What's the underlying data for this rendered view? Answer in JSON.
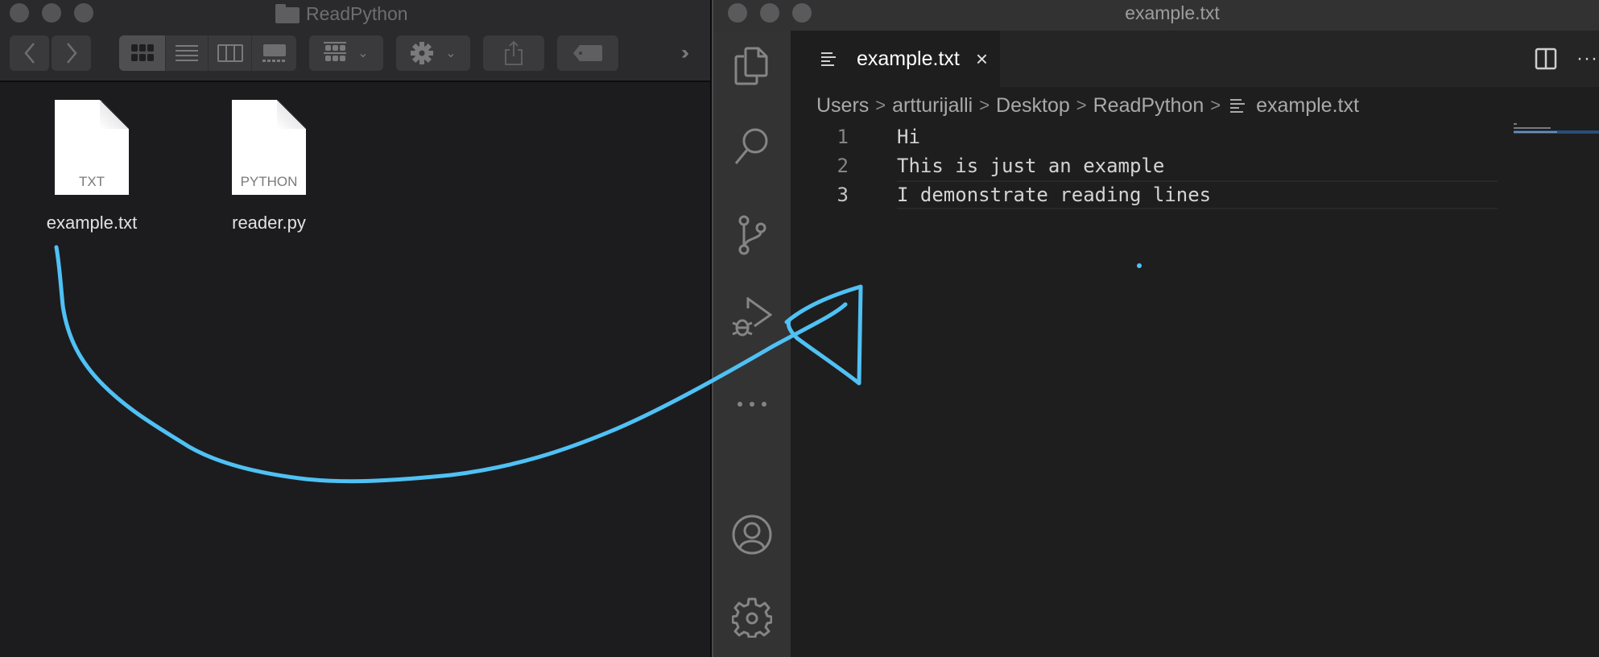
{
  "finder": {
    "title": "ReadPython",
    "toolbar": {
      "back": "back",
      "forward": "forward",
      "views": [
        "icon-view",
        "list-view",
        "column-view",
        "gallery-view"
      ],
      "active_view": "icon-view",
      "group": "group-by",
      "action": "action-menu",
      "share": "share",
      "tags": "tags",
      "more": "more"
    },
    "files": [
      {
        "name": "example.txt",
        "type_label": "TXT"
      },
      {
        "name": "reader.py",
        "type_label": "PYTHON"
      }
    ]
  },
  "vscode": {
    "window_title": "example.txt",
    "activity_bar": [
      "explorer",
      "search",
      "source-control",
      "run-and-debug",
      "more",
      "accounts",
      "manage"
    ],
    "tab": {
      "label": "example.txt",
      "close": "×"
    },
    "tab_actions": {
      "split": "split-editor",
      "more": "···"
    },
    "breadcrumb": [
      "Users",
      "artturijalli",
      "Desktop",
      "ReadPython",
      "example.txt"
    ],
    "breadcrumb_sep": ">",
    "lines": [
      {
        "number": "1",
        "text": "Hi"
      },
      {
        "number": "2",
        "text": "This is just an example"
      },
      {
        "number": "3",
        "text": "I demonstrate reading lines"
      }
    ],
    "current_line": 3
  },
  "annotation": {
    "description": "hand-drawn arrow from example.txt in Finder to VS Code editor",
    "color": "#4fc1f5"
  }
}
